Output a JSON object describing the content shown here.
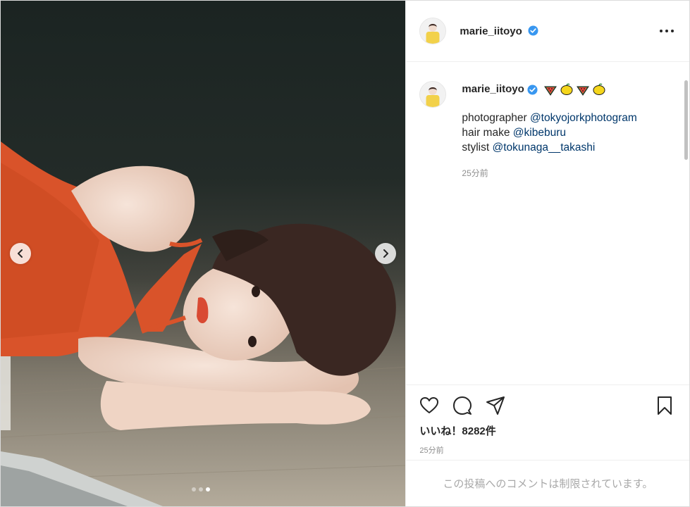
{
  "post": {
    "username": "marie_iitoyo",
    "verified": true,
    "more_icon": "more-horizontal-icon"
  },
  "media": {
    "image_description_icon": "photo-woman-lying-on-floor",
    "slide_count": 3,
    "active_slide": 3,
    "prev_icon": "chevron-left-icon",
    "next_icon": "chevron-right-icon"
  },
  "caption": {
    "username": "marie_iitoyo",
    "emojis": [
      "watermelon",
      "lemon",
      "watermelon",
      "lemon"
    ],
    "lines": [
      {
        "label": "photographer ",
        "mention": "@tokyojorkphotogram"
      },
      {
        "label": "hair make ",
        "mention": "@kibeburu"
      },
      {
        "label": "stylist ",
        "mention": "@tokunaga__takashi"
      }
    ],
    "time": "25分前"
  },
  "actions": {
    "like_icon": "heart-icon",
    "comment_icon": "comment-icon",
    "share_icon": "send-icon",
    "save_icon": "bookmark-icon",
    "likes_text": "いいね！8282件",
    "time": "25分前"
  },
  "comment_bar": {
    "text": "この投稿へのコメントは制限されています。"
  },
  "colors": {
    "mention": "#00376b",
    "verified": "#3897f0",
    "dress": "#d9532a"
  }
}
